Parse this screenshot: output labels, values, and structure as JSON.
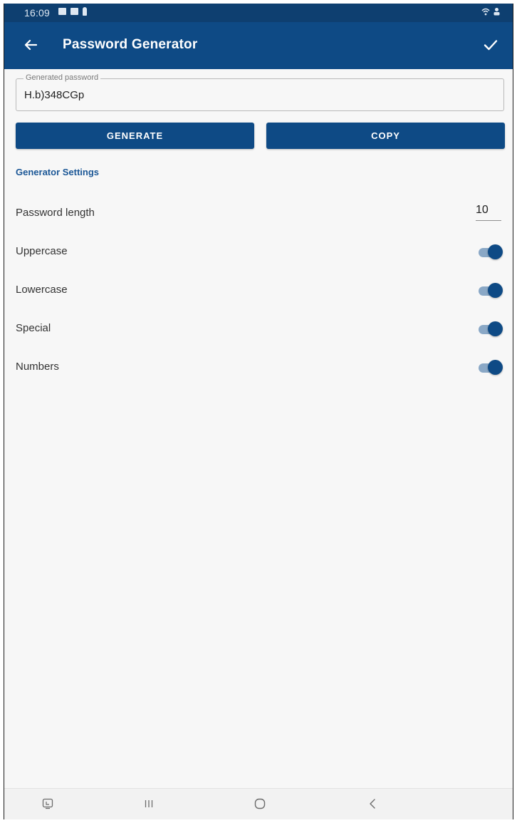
{
  "status_bar": {
    "time": "16:09",
    "icons_left": [
      "notification-icon",
      "gallery-icon",
      "person-icon"
    ],
    "icons_right": [
      "wifi-icon",
      "profile-icon"
    ]
  },
  "app_bar": {
    "title": "Password Generator",
    "back_icon": "arrow-left-icon",
    "confirm_icon": "check-icon"
  },
  "password_field": {
    "label": "Generated password",
    "value": "H.b)348CGp"
  },
  "buttons": {
    "generate": "GENERATE",
    "copy": "COPY"
  },
  "settings": {
    "header": "Generator Settings",
    "length_label": "Password length",
    "length_value": "10",
    "toggles": [
      {
        "label": "Uppercase",
        "on": true
      },
      {
        "label": "Lowercase",
        "on": true
      },
      {
        "label": "Special",
        "on": true
      },
      {
        "label": "Numbers",
        "on": true
      }
    ]
  },
  "nav_bar": {
    "items": [
      "screenshot-icon",
      "recents-icon",
      "home-icon",
      "back-icon"
    ]
  },
  "colors": {
    "primary": "#0e4a85",
    "status_bar": "#0e3f70",
    "accent_text": "#1b5796",
    "background": "#f7f7f7"
  }
}
